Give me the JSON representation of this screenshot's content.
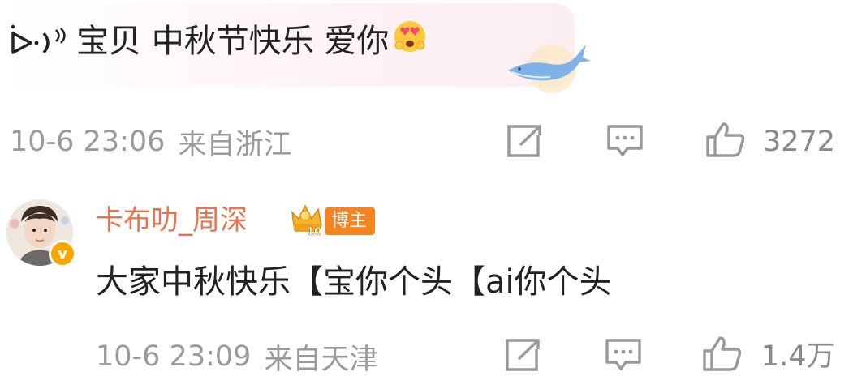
{
  "comment1": {
    "text": "宝贝 中秋节快乐 爱你",
    "icons": [
      "voice-icon",
      "heart-eyes-emoji",
      "whale-sticker"
    ],
    "time": "10-6 23:06",
    "location": "来自浙江",
    "like_count": "3272"
  },
  "comment2": {
    "username": "卡布叻_周深",
    "badge_label": "博主",
    "badge_level": "10",
    "verified_mark": "v",
    "text": "大家中秋快乐【宝你个头【ai你个头",
    "time": "10-6 23:09",
    "location": "来自天津",
    "like_count": "1.4万"
  },
  "colors": {
    "username": "#eb7350",
    "meta": "#9a9a9a",
    "badge": "#f5831f",
    "bubble_bg": "#fbeef1"
  }
}
